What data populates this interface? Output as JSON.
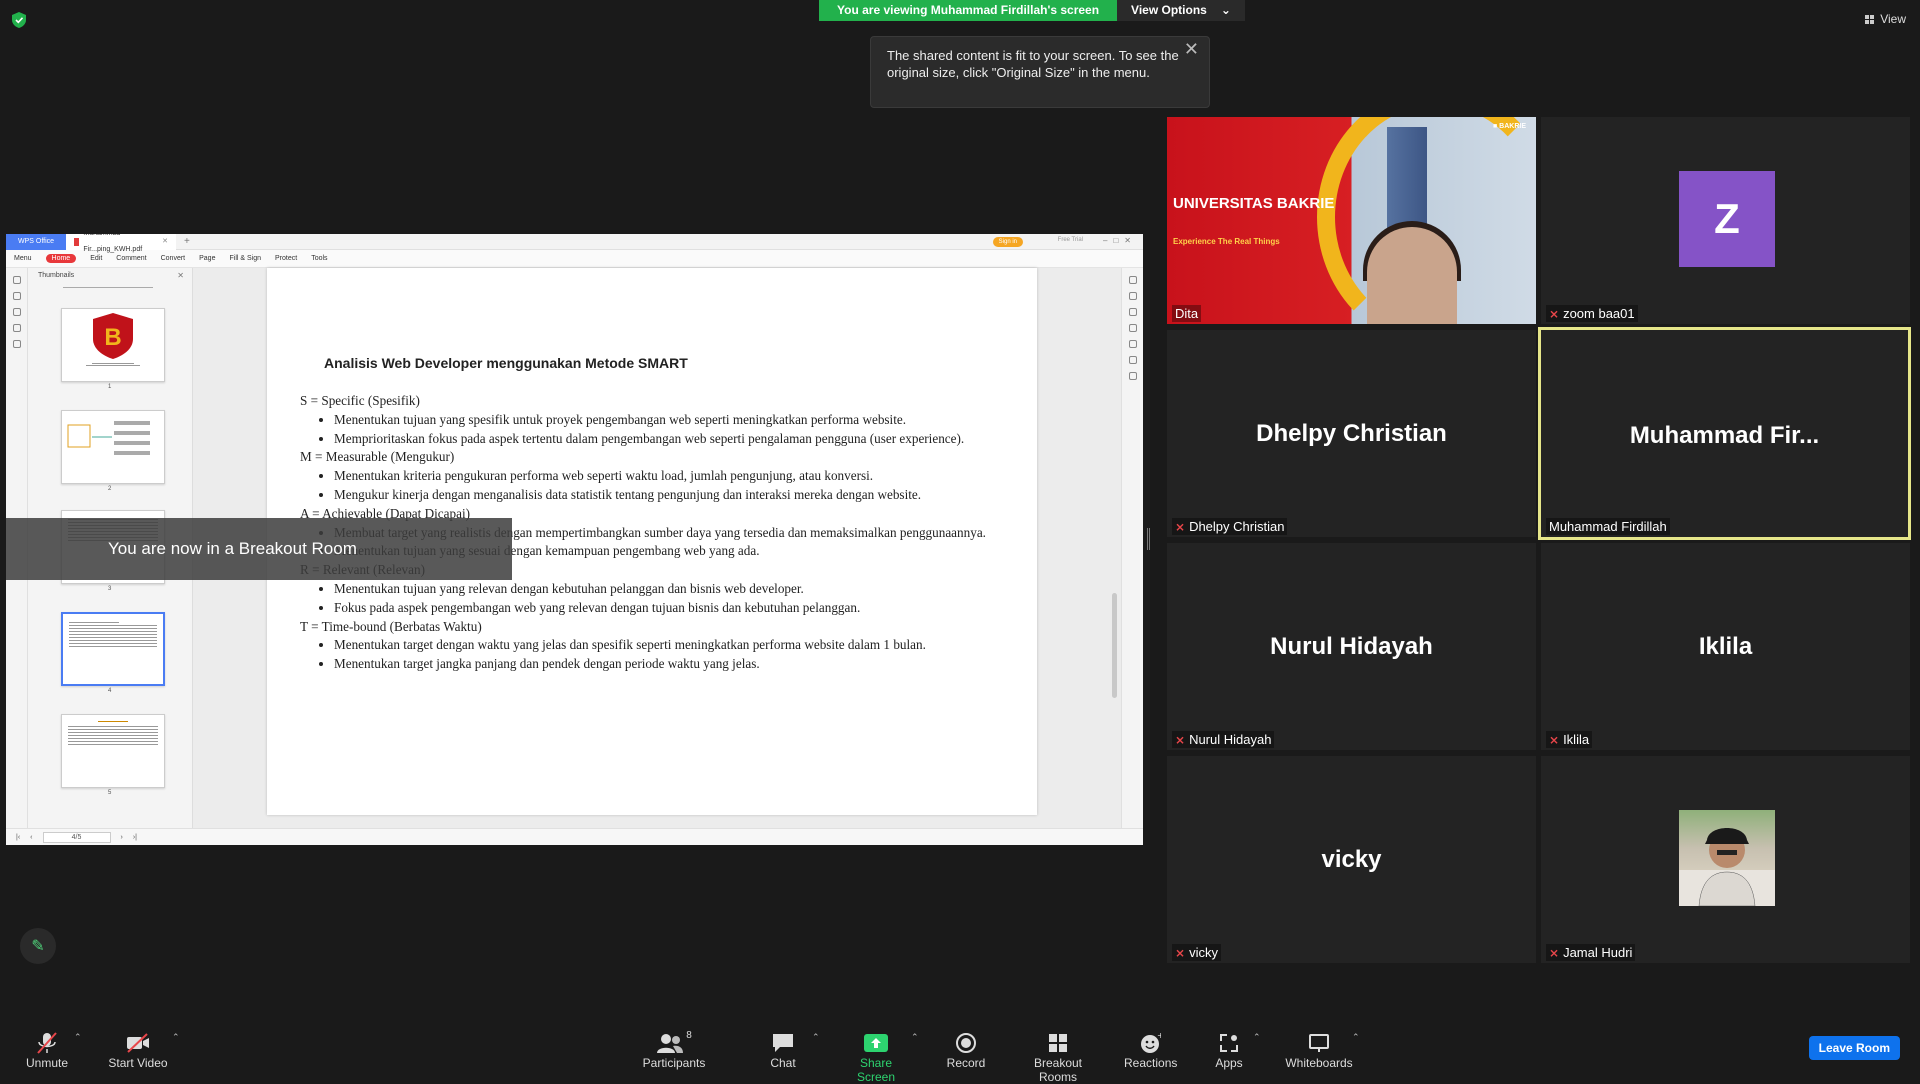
{
  "banner": {
    "viewing": "You are viewing Muhammad Firdillah's screen",
    "view_options": "View Options"
  },
  "view_button": "View",
  "tooltip": {
    "text": "The shared content is fit to your screen. To see the original size, click \"Original Size\" in the menu."
  },
  "wps": {
    "app_tab": "WPS Office",
    "doc_tab": "Muhammad Fir...ping_KWH.pdf",
    "sign_in": "Sign in",
    "free_trial": "Free Trial",
    "menu": [
      "Menu",
      "Home",
      "Edit",
      "Comment",
      "Convert",
      "Page",
      "Fill & Sign",
      "Protect",
      "Tools"
    ],
    "thumbnails_title": "Thumbnails",
    "thumb_numbers": [
      "1",
      "2",
      "3",
      "4",
      "5"
    ],
    "page_indicator": "4/5"
  },
  "document": {
    "title": "Analisis Web Developer menggunakan Metode SMART",
    "sections": [
      {
        "head": "S = Specific (Spesifik)",
        "items": [
          "Menentukan tujuan yang spesifik untuk proyek pengembangan web seperti meningkatkan performa website.",
          "Memprioritaskan fokus pada aspek tertentu dalam pengembangan web seperti pengalaman pengguna (user experience)."
        ]
      },
      {
        "head": "M = Measurable (Mengukur)",
        "items": [
          "Menentukan kriteria pengukuran performa web seperti waktu load, jumlah pengunjung, atau konversi.",
          "Mengukur kinerja dengan menganalisis data statistik tentang pengunjung dan interaksi mereka dengan website."
        ]
      },
      {
        "head": "A = Achievable (Dapat Dicapai)",
        "items": [
          "Membuat target yang realistis dengan mempertimbangkan sumber daya yang tersedia dan memaksimalkan penggunaannya.",
          "Menentukan tujuan yang sesuai dengan kemampuan pengembang web yang ada."
        ]
      },
      {
        "head": "R = Relevant (Relevan)",
        "items": [
          "Menentukan tujuan yang relevan dengan kebutuhan pelanggan dan bisnis web developer.",
          "Fokus pada aspek pengembangan web yang relevan dengan tujuan bisnis dan kebutuhan pelanggan."
        ]
      },
      {
        "head": "T = Time-bound (Berbatas Waktu)",
        "items": [
          "Menentukan target dengan waktu yang jelas dan spesifik seperti meningkatkan performa website dalam 1 bulan.",
          "Menentukan target jangka panjang dan pendek dengan periode waktu yang jelas."
        ]
      }
    ]
  },
  "breakout_toast": "You are now in a Breakout Room",
  "participants": [
    {
      "label": "Dita",
      "big": "",
      "muted": false,
      "video": "UNIVERSITAS BAKRIE",
      "tagline": "Experience The Real Things"
    },
    {
      "label": "zoom baa01",
      "big": "",
      "avatar": "Z",
      "muted": true
    },
    {
      "label": "Dhelpy Christian",
      "big": "Dhelpy Christian",
      "muted": true
    },
    {
      "label": "Muhammad Firdillah",
      "big": "Muhammad  Fir...",
      "muted": false,
      "speaking": true
    },
    {
      "label": "Nurul Hidayah",
      "big": "Nurul Hidayah",
      "muted": true
    },
    {
      "label": "Iklila",
      "big": "Iklila",
      "muted": true
    },
    {
      "label": "vicky",
      "big": "vicky",
      "muted": true
    },
    {
      "label": "Jamal Hudri",
      "big": "",
      "muted": true
    }
  ],
  "toolbar": {
    "unmute": "Unmute",
    "start_video": "Start Video",
    "participants": "Participants",
    "participants_count": "8",
    "chat": "Chat",
    "share_screen": "Share Screen",
    "record": "Record",
    "breakout_rooms": "Breakout Rooms",
    "reactions": "Reactions",
    "apps": "Apps",
    "whiteboards": "Whiteboards",
    "leave_room": "Leave Room"
  },
  "colors": {
    "share_green": "#22b14c",
    "leave_blue": "#0e72ed",
    "speaker_border": "#e6e68a",
    "mute_red": "#e8464a"
  }
}
